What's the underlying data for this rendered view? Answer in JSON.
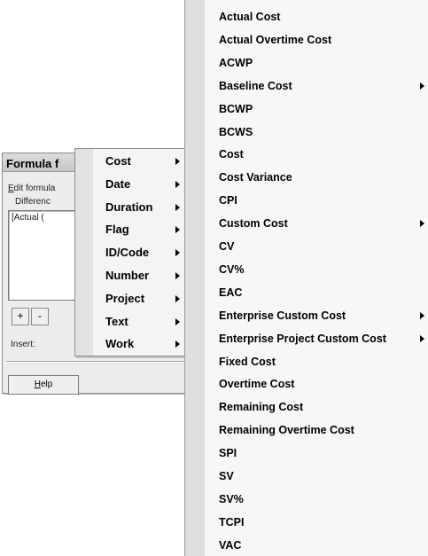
{
  "dialog": {
    "title": "Formula f",
    "edit_label_underlined": "E",
    "edit_label_rest": "dit formula",
    "difference_label": "Differenc",
    "formula_text": "[Actual (",
    "plus_label": "+",
    "minus_label": "-",
    "insert_label": "Insert:",
    "help_underlined": "H",
    "help_rest": "elp"
  },
  "category_menu": {
    "items": [
      {
        "label": "Cost",
        "has_submenu": true
      },
      {
        "label": "Date",
        "has_submenu": true
      },
      {
        "label": "Duration",
        "has_submenu": true
      },
      {
        "label": "Flag",
        "has_submenu": true
      },
      {
        "label": "ID/Code",
        "has_submenu": true
      },
      {
        "label": "Number",
        "has_submenu": true
      },
      {
        "label": "Project",
        "has_submenu": true
      },
      {
        "label": "Text",
        "has_submenu": true
      },
      {
        "label": "Work",
        "has_submenu": true
      }
    ]
  },
  "cost_menu": {
    "items": [
      {
        "label": "Actual Cost",
        "has_submenu": false
      },
      {
        "label": "Actual Overtime Cost",
        "has_submenu": false
      },
      {
        "label": "ACWP",
        "has_submenu": false
      },
      {
        "label": "Baseline Cost",
        "has_submenu": true
      },
      {
        "label": "BCWP",
        "has_submenu": false
      },
      {
        "label": "BCWS",
        "has_submenu": false
      },
      {
        "label": "Cost",
        "has_submenu": false
      },
      {
        "label": "Cost Variance",
        "has_submenu": false
      },
      {
        "label": "CPI",
        "has_submenu": false
      },
      {
        "label": "Custom Cost",
        "has_submenu": true
      },
      {
        "label": "CV",
        "has_submenu": false
      },
      {
        "label": "CV%",
        "has_submenu": false
      },
      {
        "label": "EAC",
        "has_submenu": false
      },
      {
        "label": "Enterprise Custom Cost",
        "has_submenu": true
      },
      {
        "label": "Enterprise Project Custom Cost",
        "has_submenu": true
      },
      {
        "label": "Fixed Cost",
        "has_submenu": false
      },
      {
        "label": "Overtime Cost",
        "has_submenu": false
      },
      {
        "label": "Remaining Cost",
        "has_submenu": false
      },
      {
        "label": "Remaining Overtime Cost",
        "has_submenu": false
      },
      {
        "label": "SPI",
        "has_submenu": false
      },
      {
        "label": "SV",
        "has_submenu": false
      },
      {
        "label": "SV%",
        "has_submenu": false
      },
      {
        "label": "TCPI",
        "has_submenu": false
      },
      {
        "label": "VAC",
        "has_submenu": false
      }
    ]
  }
}
